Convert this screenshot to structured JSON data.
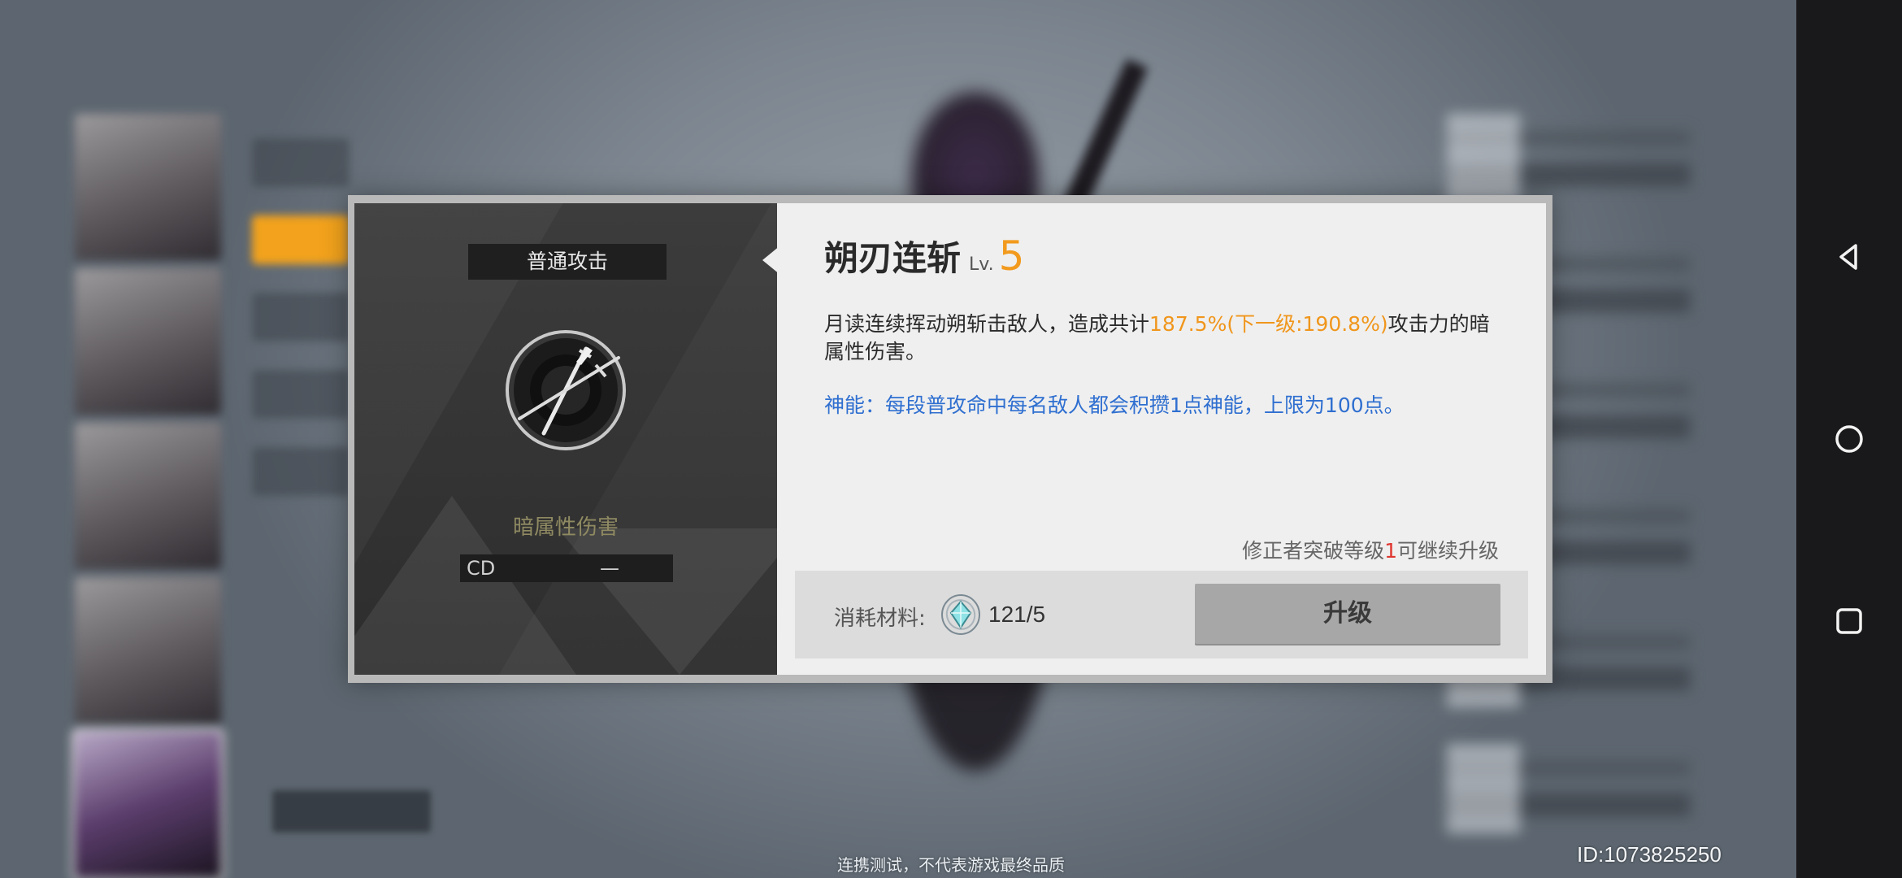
{
  "skill": {
    "category": "普通攻击",
    "damage_type": "暗属性伤害",
    "cd_label": "CD",
    "cd_value": "—",
    "name": "朔刃连斩",
    "level_prefix": "Lv.",
    "level": "5",
    "desc_part1": "月读连续挥动朔斩击敌人，造成共计",
    "desc_highlight": "187.5%(下一级:190.8%)",
    "desc_part2": "攻击力的暗属性伤害。",
    "god_power": "神能：每段普攻命中每名敌人都会积攒1点神能，上限为100点。",
    "req_part1": "修正者突破等级",
    "req_level": "1",
    "req_part2": "可继续升级"
  },
  "footer": {
    "materials_label": "消耗材料:",
    "materials_count": "121/5",
    "upgrade_label": "升级"
  },
  "overlay": {
    "watermark": "连携测试，不代表游戏最终品质",
    "uid": "ID:1073825250"
  },
  "colors": {
    "accent_orange": "#f29a1e",
    "god_blue": "#2f6fd0",
    "requirement_red": "#e0362f",
    "damage_type": "#8f8a62"
  },
  "icons": {
    "skill": "crossed-swords-icon",
    "material": "crystal-gem-icon",
    "nav": [
      "nav-back-icon",
      "nav-home-icon",
      "nav-recents-icon"
    ]
  }
}
